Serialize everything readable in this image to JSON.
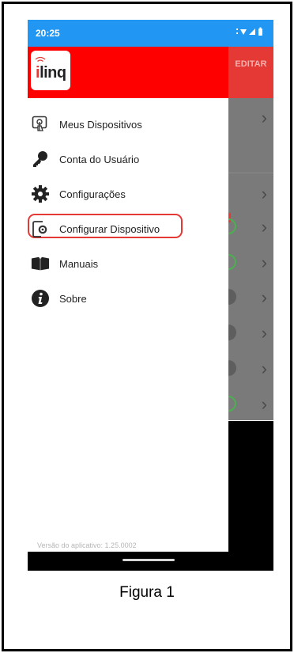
{
  "status_bar": {
    "time": "20:25",
    "icons": "⋮▾◢▮",
    "background": "#2196f3"
  },
  "app": {
    "logo_text_prefix": "i",
    "logo_text_rest": "linq",
    "header_color": "#ff0000",
    "edit_label": "EDITAR"
  },
  "drawer": {
    "items": [
      {
        "label": "Meus Dispositivos",
        "icon": "touch-device-icon"
      },
      {
        "label": "Conta do Usuário",
        "icon": "key-icon"
      },
      {
        "label": "Configurações",
        "icon": "gear-icon"
      },
      {
        "label": "Configurar Dispositivo",
        "icon": "device-settings-icon",
        "highlighted": true
      },
      {
        "label": "Manuais",
        "icon": "book-icon"
      },
      {
        "label": "Sobre",
        "icon": "info-icon"
      }
    ],
    "version": "Versão do aplicativo: 1.25.0002"
  },
  "caption": "Figura 1",
  "colors": {
    "highlight": "#e53935",
    "accent": "#2196f3"
  }
}
